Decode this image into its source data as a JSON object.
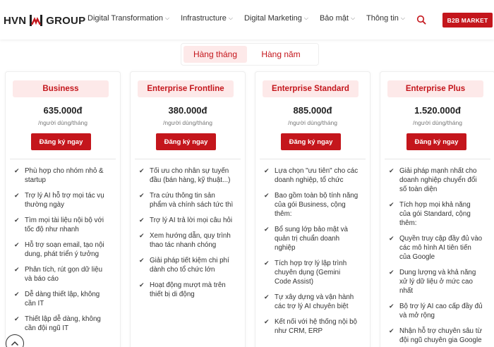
{
  "header": {
    "logo_left": "HVN",
    "logo_right": "GROUP",
    "nav": [
      {
        "label": "Digital Transformation"
      },
      {
        "label": "Infrastructure"
      },
      {
        "label": "Digital Marketing"
      },
      {
        "label": "Bảo mật"
      },
      {
        "label": "Thông tin"
      }
    ],
    "b2b_label": "B2B MARKET"
  },
  "billing_toggle": {
    "monthly": "Hàng tháng",
    "yearly": "Hàng năm"
  },
  "plans": [
    {
      "name": "Business",
      "price": "635.000đ",
      "unit": "/người dùng/tháng",
      "cta": "Đăng ký ngay",
      "features": [
        "Phù hợp cho nhóm nhỏ & startup",
        "Trợ lý AI hỗ trợ mọi tác vụ thường ngày",
        "Tìm mọi tài liệu nội bộ với tốc độ như nhanh",
        "Hỗ trợ soạn email, tạo nội dung, phát triển ý tưởng",
        "Phân tích, rút gọn dữ liệu và báo cáo",
        "Dễ dàng thiết lập, không cần IT",
        "Thiết lập dễ dàng, không cần đội ngũ IT"
      ]
    },
    {
      "name": "Enterprise Frontline",
      "price": "380.000đ",
      "unit": "/người dùng/tháng",
      "cta": "Đăng ký ngay",
      "features": [
        "Tối ưu cho nhân sự tuyến đầu (bán hàng, kỹ thuật...)",
        "Tra cứu thông tin sản phẩm và chính sách tức thì",
        "Trợ lý AI trả lời mọi câu hỏi",
        "Xem hướng dẫn, quy trình thao tác nhanh chóng",
        "Giải pháp tiết kiệm chi phí dành cho tổ chức lớn",
        "Hoạt động mượt mà trên thiết bị di động"
      ]
    },
    {
      "name": "Enterprise Standard",
      "price": "885.000đ",
      "unit": "/người dùng/tháng",
      "cta": "Đăng ký ngay",
      "features": [
        "Lựa chọn \"ưu tiên\" cho các doanh nghiệp, tổ chức",
        "Bao gồm toàn bộ tính năng của gói Business, cộng thêm:",
        "Bổ sung lớp bảo mật và quản trị chuẩn doanh nghiệp",
        "Tích hợp trợ lý lập trình chuyên dụng (Gemini Code Assist)",
        "Tự xây dựng và vận hành các trợ lý AI chuyên biệt",
        "Kết nối với hệ thống nội bộ như CRM, ERP"
      ]
    },
    {
      "name": "Enterprise Plus",
      "price": "1.520.000đ",
      "unit": "/người dùng/tháng",
      "cta": "Đăng ký ngay",
      "features": [
        "Giải pháp mạnh nhất cho doanh nghiệp chuyển đổi số toàn diện",
        "Tích hợp mọi khả năng của gói Standard, cộng thêm:",
        "Quyền truy cập đầy đủ vào các mô hình AI tiên tiến của Google",
        "Dung lượng và khả năng xử lý dữ liệu ở mức cao nhất",
        "Bộ trợ lý AI cao cấp đầy đủ và mở rộng",
        "Nhận hỗ trợ chuyên sâu từ đội ngũ chuyên gia Google"
      ]
    }
  ],
  "colors": {
    "brand_red": "#c4161c",
    "pill_bg": "#fde9e9"
  },
  "icons": {
    "search": "search-icon",
    "check": "check-icon",
    "scroll_top": "chevron-up-icon"
  }
}
